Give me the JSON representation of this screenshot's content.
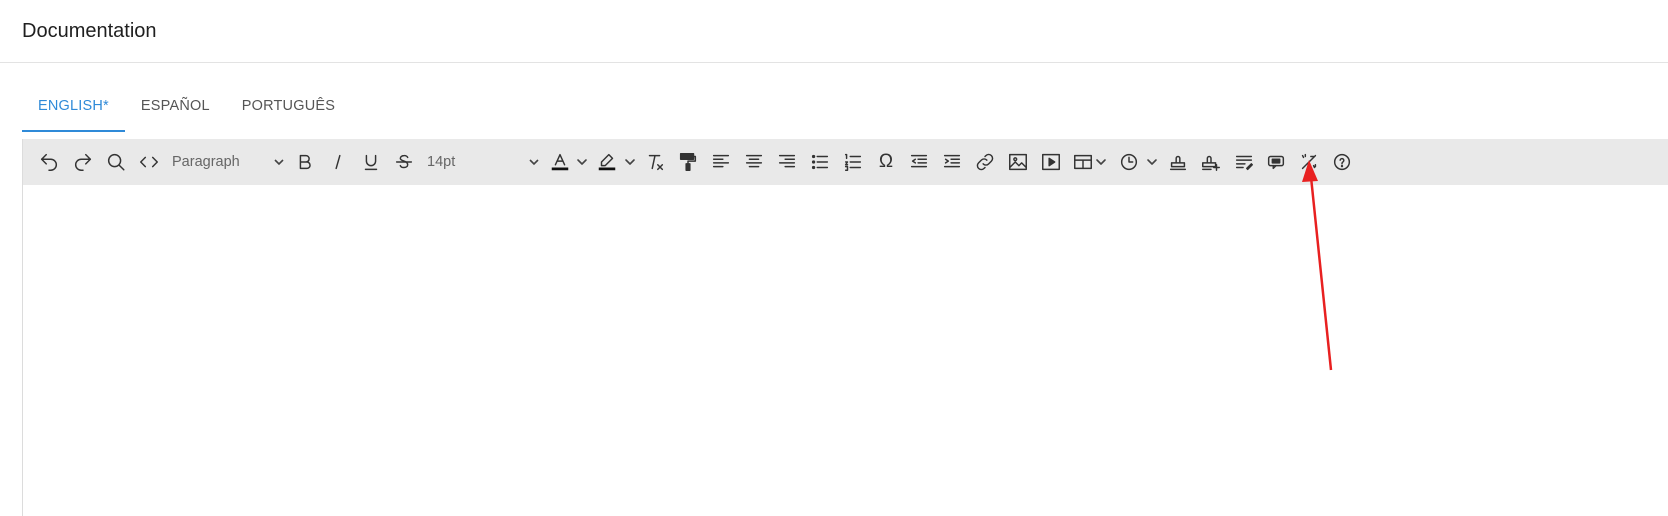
{
  "header": {
    "title": "Documentation"
  },
  "tabs": [
    {
      "label": "ENGLISH*",
      "active": true
    },
    {
      "label": "ESPAÑOL",
      "active": false
    },
    {
      "label": "PORTUGUÊS",
      "active": false
    }
  ],
  "toolbar": {
    "block_format": "Paragraph",
    "font_size": "14pt",
    "buttons": [
      "undo-icon",
      "redo-icon",
      "search-icon",
      "code-icon",
      "bold-icon",
      "italic-icon",
      "underline-icon",
      "strikethrough-icon",
      "text-color-icon",
      "highlight-color-icon",
      "clear-formatting-icon",
      "format-painter-icon",
      "align-left-icon",
      "align-center-icon",
      "align-right-icon",
      "bullet-list-icon",
      "numbered-list-icon",
      "special-character-icon",
      "outdent-icon",
      "indent-icon",
      "link-icon",
      "image-icon",
      "media-icon",
      "table-icon",
      "datetime-icon",
      "stamp-icon",
      "add-stamp-icon",
      "text-direction-icon",
      "template-icon",
      "magic-wand-icon",
      "help-icon"
    ]
  },
  "colors": {
    "accent": "#2f8ad8",
    "toolbar_bg": "#e9e9e9",
    "arrow": "#e82020"
  },
  "editor": {
    "content": ""
  }
}
